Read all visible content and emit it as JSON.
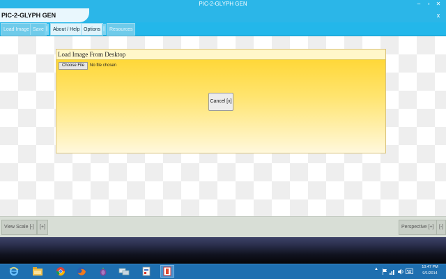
{
  "window": {
    "title": "PIC-2-GLYPH GEN",
    "minimize": "–",
    "restore": "▫",
    "close": "✕"
  },
  "app": {
    "title": "PIC-2-GLYPH GEN",
    "close_label": "x"
  },
  "menu": {
    "load_image": "Load Image",
    "save": "Save",
    "sep": "|",
    "about_help": "About / Help",
    "options": "Options",
    "resources": "Resources"
  },
  "dialog": {
    "title": "Load Image From Desktop",
    "choose_file": "Choose File",
    "file_status": "No file chosen",
    "cancel": "Cancel [x]"
  },
  "bottom": {
    "view_scale": "View Scale [-]",
    "zoom_in": "[+]",
    "perspective": "Perspective [+]",
    "perspective_minus": "[-]"
  },
  "taskbar": {
    "apps": [
      "internet-explorer",
      "file-explorer",
      "chrome",
      "firefox",
      "tor-browser",
      "network-app",
      "paint-app",
      "pic2glyph-app"
    ],
    "tray_arrow": "▲",
    "time": "10:47 PM",
    "date": "9/1/2014"
  },
  "colors": {
    "accent": "#2bb6e8",
    "dialog_top": "#ffd42a",
    "dialog_bottom": "#fff8dc",
    "taskbar": "#1e6fb0"
  }
}
